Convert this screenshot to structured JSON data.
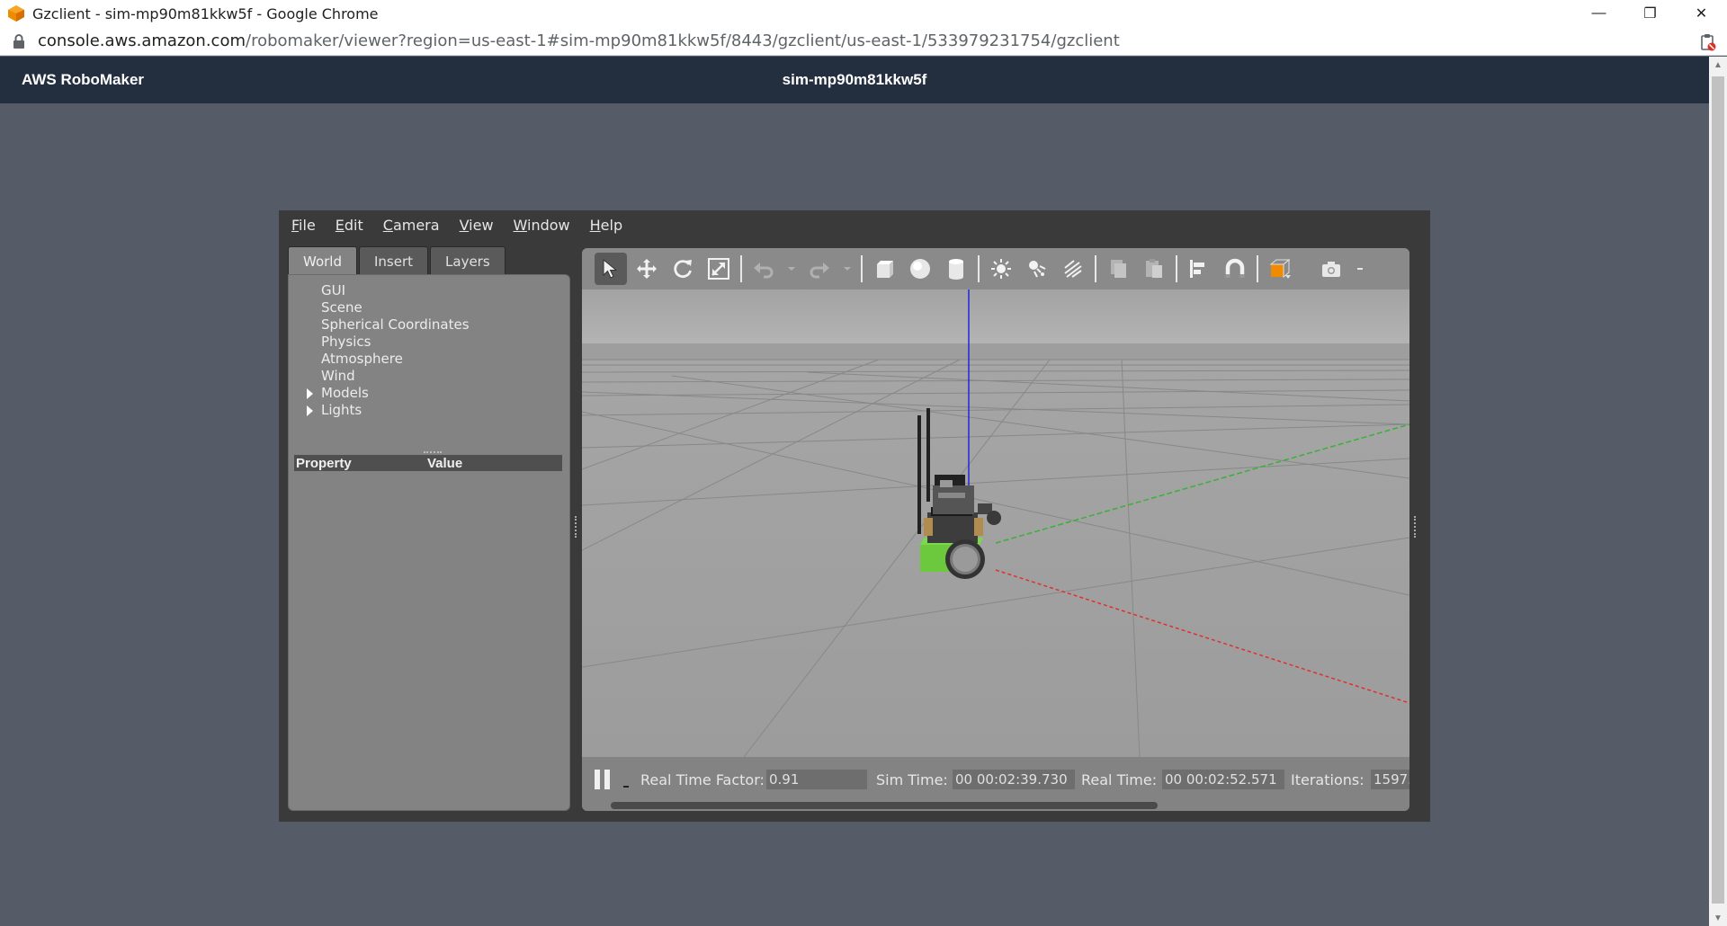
{
  "browser": {
    "window_title": "Gzclient - sim-mp90m81kkw5f - Google Chrome",
    "url_host": "console.aws.amazon.com",
    "url_path": "/robomaker/viewer?region=us-east-1#sim-mp90m81kkw5f/8443/gzclient/us-east-1/533979231754/gzclient",
    "controls": {
      "minimize": "—",
      "restore": "❐",
      "close": "✕"
    }
  },
  "header": {
    "brand": "AWS RoboMaker",
    "simulation_name": "sim-mp90m81kkw5f"
  },
  "gazebo": {
    "menu": [
      {
        "first": "F",
        "rest": "ile"
      },
      {
        "first": "E",
        "rest": "dit"
      },
      {
        "first": "C",
        "rest": "amera"
      },
      {
        "first": "V",
        "rest": "iew"
      },
      {
        "first": "W",
        "rest": "indow"
      },
      {
        "first": "H",
        "rest": "elp"
      }
    ],
    "tabs": [
      "World",
      "Insert",
      "Layers"
    ],
    "active_tab": "World",
    "tree": [
      {
        "label": "GUI",
        "expandable": false
      },
      {
        "label": "Scene",
        "expandable": false
      },
      {
        "label": "Spherical Coordinates",
        "expandable": false
      },
      {
        "label": "Physics",
        "expandable": false
      },
      {
        "label": "Atmosphere",
        "expandable": false
      },
      {
        "label": "Wind",
        "expandable": false
      },
      {
        "label": "Models",
        "expandable": true
      },
      {
        "label": "Lights",
        "expandable": true
      }
    ],
    "property_header": {
      "property": "Property",
      "value": "Value"
    },
    "toolbar_icons": [
      "select-icon",
      "translate-icon",
      "rotate-icon",
      "scale-icon",
      "undo-icon",
      "redo-icon",
      "box-icon",
      "sphere-icon",
      "cylinder-icon",
      "point-light-icon",
      "spot-light-icon",
      "directional-light-icon",
      "copy-icon",
      "paste-icon",
      "align-icon",
      "snap-icon",
      "view-angle-icon",
      "screenshot-icon"
    ],
    "status": {
      "real_time_factor_label": "Real Time Factor:",
      "real_time_factor": "0.91",
      "sim_time_label": "Sim Time:",
      "sim_time": "00 00:02:39.730",
      "real_time_label": "Real Time:",
      "real_time": "00 00:02:52.571",
      "iterations_label": "Iterations:",
      "iterations": "1597."
    },
    "colors": {
      "x_axis": "#e03030",
      "y_axis": "#3ab03a",
      "z_axis": "#2020e0",
      "robot_base": "#6cc83c",
      "view_angle_accent": "#f08a00"
    }
  }
}
